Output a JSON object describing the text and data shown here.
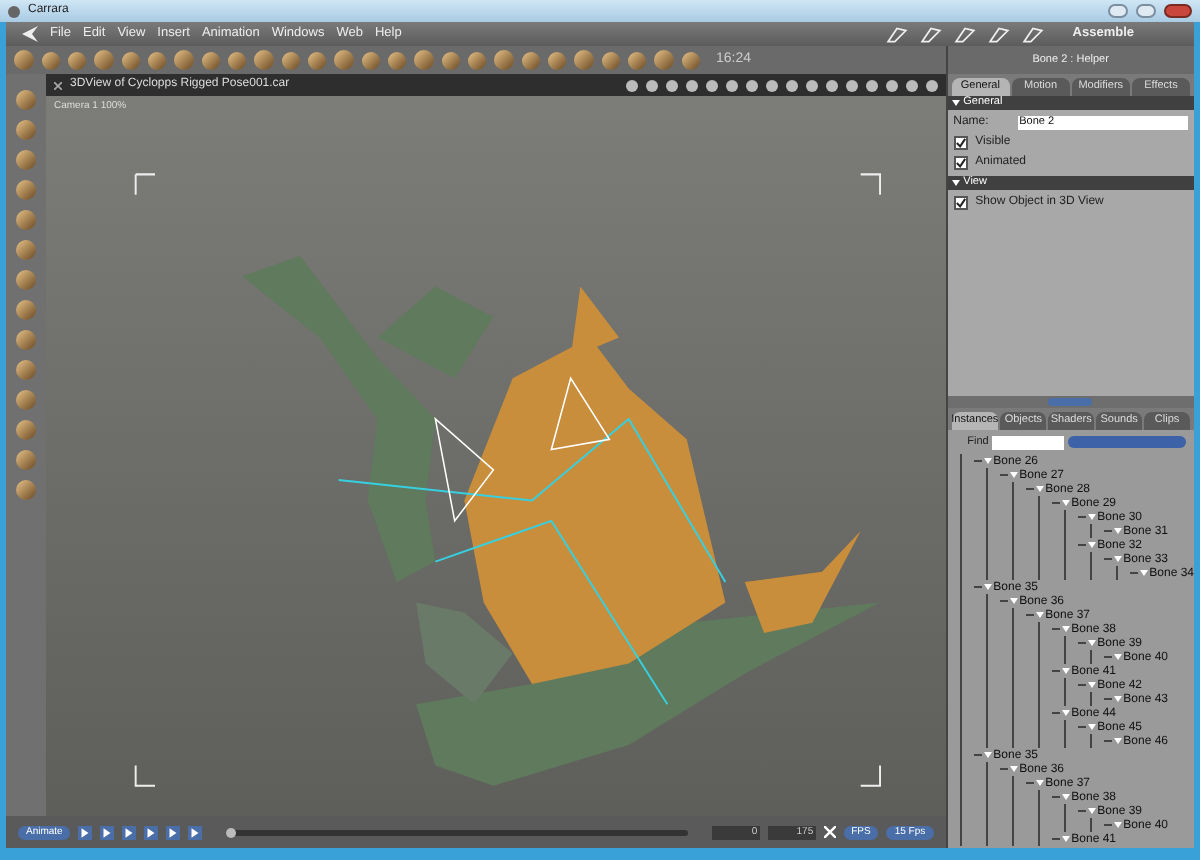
{
  "window": {
    "title": "Carrara"
  },
  "menu": [
    "File",
    "Edit",
    "View",
    "Insert",
    "Animation",
    "Windows",
    "Web",
    "Help"
  ],
  "room": "Assemble",
  "toolbar": {
    "time": "16:24"
  },
  "viewport": {
    "title": "3DView of Cyclopps Rigged Pose001.car",
    "camera": "Camera 1 100%"
  },
  "properties": {
    "title": "Bone 2 : Helper",
    "tabs": [
      {
        "label": "General",
        "selected": true
      },
      {
        "label": "Motion",
        "selected": false
      },
      {
        "label": "Modifiers",
        "selected": false
      },
      {
        "label": "Effects",
        "selected": false
      }
    ],
    "sections": [
      {
        "title": "General",
        "name_label": "Name:",
        "name_value": "Bone 2",
        "options": [
          {
            "label": "Visible",
            "checked": true
          },
          {
            "label": "Animated",
            "checked": true
          }
        ]
      },
      {
        "title": "View",
        "options": [
          {
            "label": "Show Object in 3D View",
            "checked": true
          }
        ]
      }
    ]
  },
  "browser": {
    "tabs": [
      {
        "label": "Instances",
        "selected": true
      },
      {
        "label": "Objects",
        "selected": false
      },
      {
        "label": "Shaders",
        "selected": false
      },
      {
        "label": "Sounds",
        "selected": false
      },
      {
        "label": "Clips",
        "selected": false
      }
    ],
    "find_label": "Find",
    "tree": [
      {
        "label": "Bone 26",
        "children": [
          {
            "label": "Bone 27",
            "children": [
              {
                "label": "Bone 28",
                "children": [
                  {
                    "label": "Bone 29",
                    "children": [
                      {
                        "label": "Bone 30",
                        "children": [
                          {
                            "label": "Bone 31"
                          }
                        ]
                      },
                      {
                        "label": "Bone 32",
                        "children": [
                          {
                            "label": "Bone 33",
                            "children": [
                              {
                                "label": "Bone 34"
                              }
                            ]
                          }
                        ]
                      }
                    ]
                  }
                ]
              }
            ]
          }
        ]
      },
      {
        "label": "Bone 35",
        "children": [
          {
            "label": "Bone 36",
            "children": [
              {
                "label": "Bone 37",
                "children": [
                  {
                    "label": "Bone 38",
                    "children": [
                      {
                        "label": "Bone 39",
                        "children": [
                          {
                            "label": "Bone 40"
                          }
                        ]
                      }
                    ]
                  },
                  {
                    "label": "Bone 41",
                    "children": [
                      {
                        "label": "Bone 42",
                        "children": [
                          {
                            "label": "Bone 43"
                          }
                        ]
                      }
                    ]
                  },
                  {
                    "label": "Bone 44",
                    "children": [
                      {
                        "label": "Bone 45",
                        "children": [
                          {
                            "label": "Bone 46"
                          }
                        ]
                      }
                    ]
                  }
                ]
              }
            ]
          }
        ]
      },
      {
        "label": "Bone 35",
        "children": [
          {
            "label": "Bone 36",
            "children": [
              {
                "label": "Bone 37",
                "children": [
                  {
                    "label": "Bone 38",
                    "children": [
                      {
                        "label": "Bone 39",
                        "children": [
                          {
                            "label": "Bone 40"
                          }
                        ]
                      }
                    ]
                  },
                  {
                    "label": "Bone 41"
                  }
                ]
              }
            ]
          }
        ]
      }
    ]
  },
  "timeline": {
    "level": 0,
    "animate_button": "Animate",
    "start": "0",
    "end": "175",
    "fps_mode": "FPS",
    "fps_rate": "15 Fps"
  }
}
